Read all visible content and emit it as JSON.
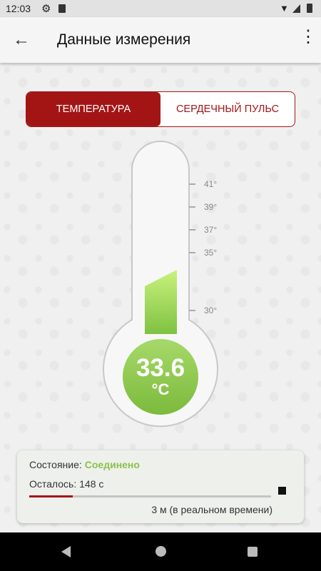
{
  "status_bar": {
    "time": "12:03"
  },
  "app_bar": {
    "title": "Данные измерения"
  },
  "tabs": [
    {
      "label": "ТЕМПЕРАТУРА",
      "active": true
    },
    {
      "label": "СЕРДЕЧНЫЙ ПУЛЬС",
      "active": false
    }
  ],
  "thermometer": {
    "value": "33.6",
    "unit": "°C",
    "ticks": [
      "41°",
      "39°",
      "37°",
      "35°",
      "30°"
    ]
  },
  "status_card": {
    "state_label": "Состояние:",
    "state_value": "Соединено",
    "remaining": "Осталось: 148 с",
    "progress_fraction": 0.18,
    "duration": "3 м (в реальном времени)"
  },
  "colors": {
    "accent": "#a31515",
    "green": "#8bc34a",
    "fill_light": "#c8f07a"
  }
}
